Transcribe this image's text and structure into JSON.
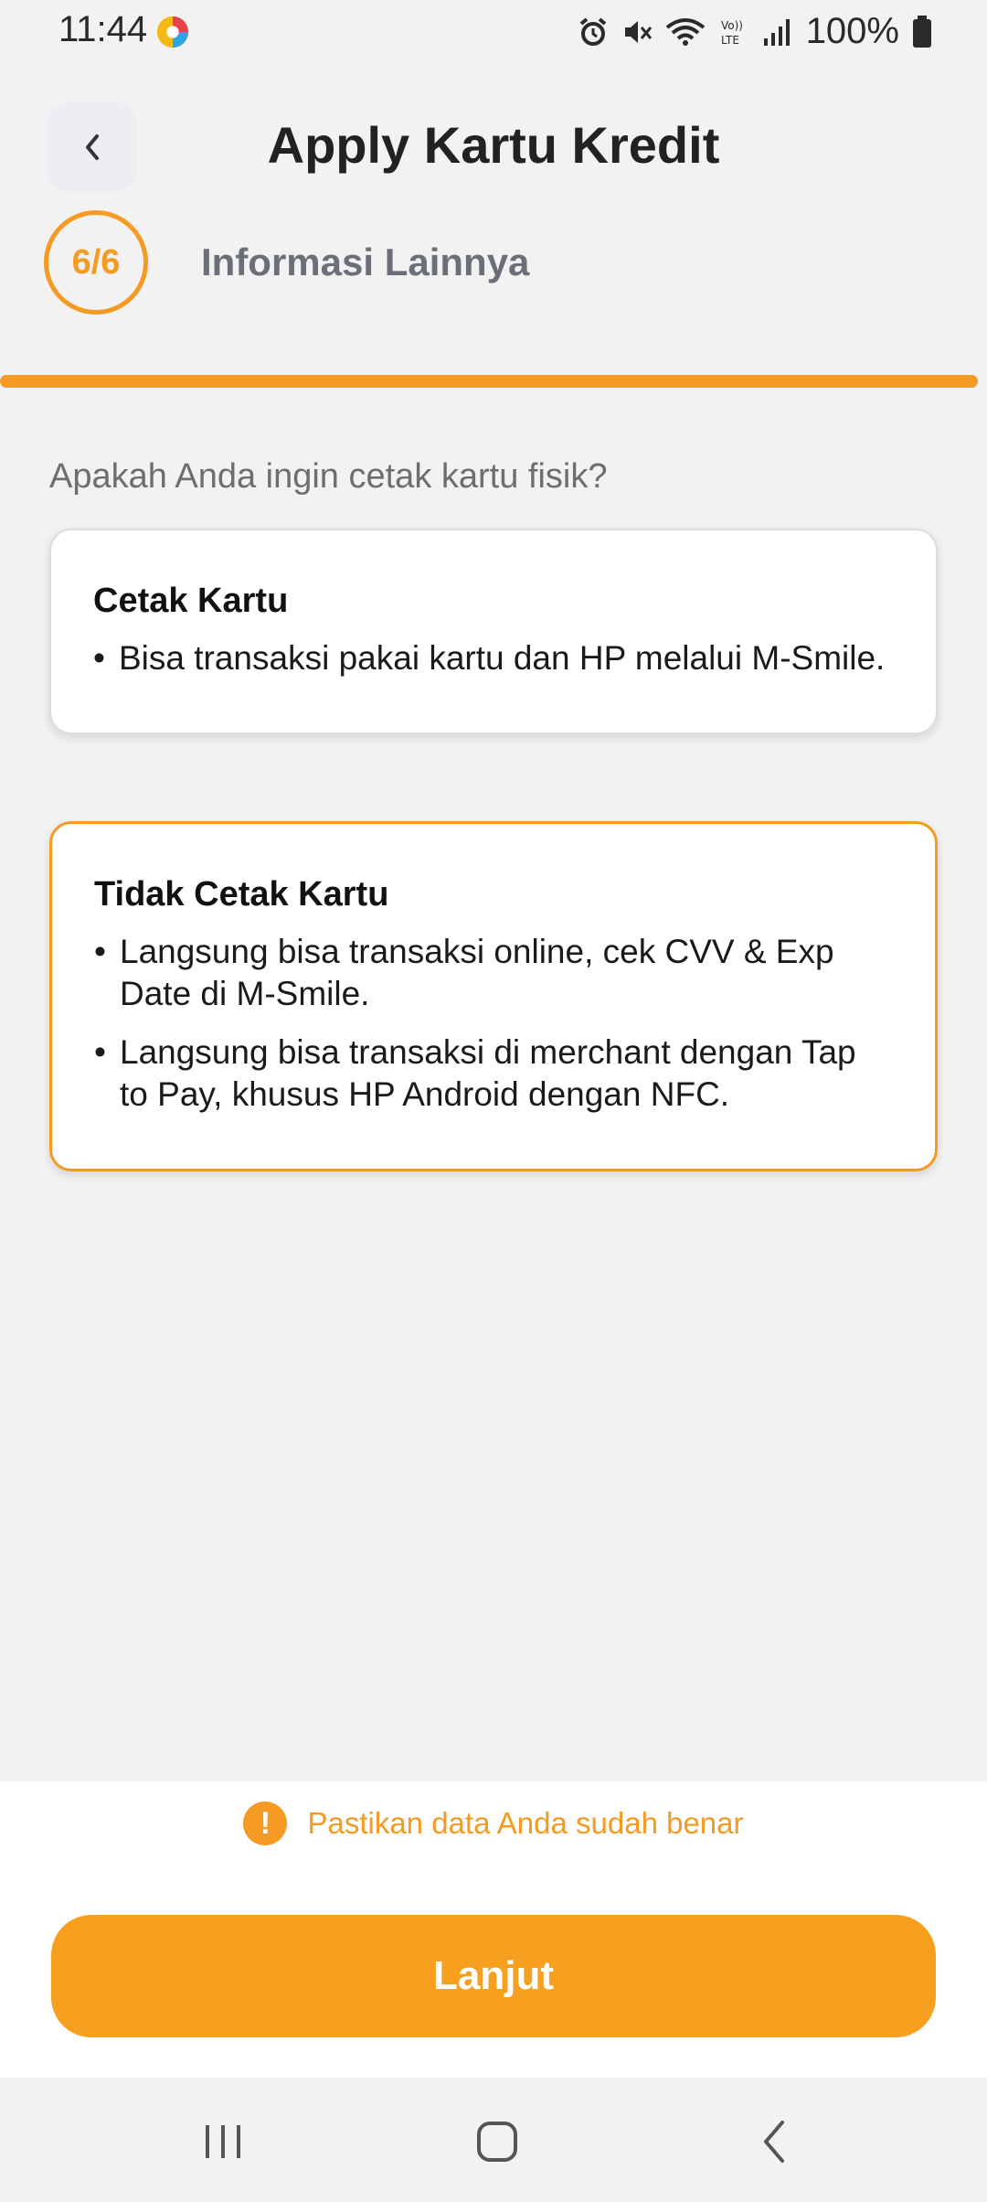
{
  "status_bar": {
    "time": "11:44",
    "battery": "100%",
    "icons": [
      "app-notification-icon",
      "alarm-icon",
      "mute-icon",
      "wifi-icon",
      "volte-icon",
      "signal-icon",
      "battery-icon"
    ]
  },
  "header": {
    "title": "Apply Kartu Kredit",
    "step": "6/6",
    "step_title": "Informasi Lainnya",
    "progress_percent": 100
  },
  "question": "Apakah Anda ingin cetak kartu fisik?",
  "options": [
    {
      "title": "Cetak Kartu",
      "selected": false,
      "bullets": [
        "Bisa transaksi pakai kartu dan HP melalui M-Smile."
      ]
    },
    {
      "title": "Tidak Cetak Kartu",
      "selected": true,
      "bullets": [
        "Langsung bisa transaksi online, cek CVV & Exp Date di M-Smile.",
        "Langsung bisa transaksi di merchant dengan Tap to Pay, khusus HP Android dengan NFC."
      ]
    }
  ],
  "notice": {
    "icon": "!",
    "text": "Pastikan data Anda sudah benar"
  },
  "primary_button": "Lanjut",
  "colors": {
    "accent": "#f59a23",
    "background": "#f2f2f2"
  }
}
